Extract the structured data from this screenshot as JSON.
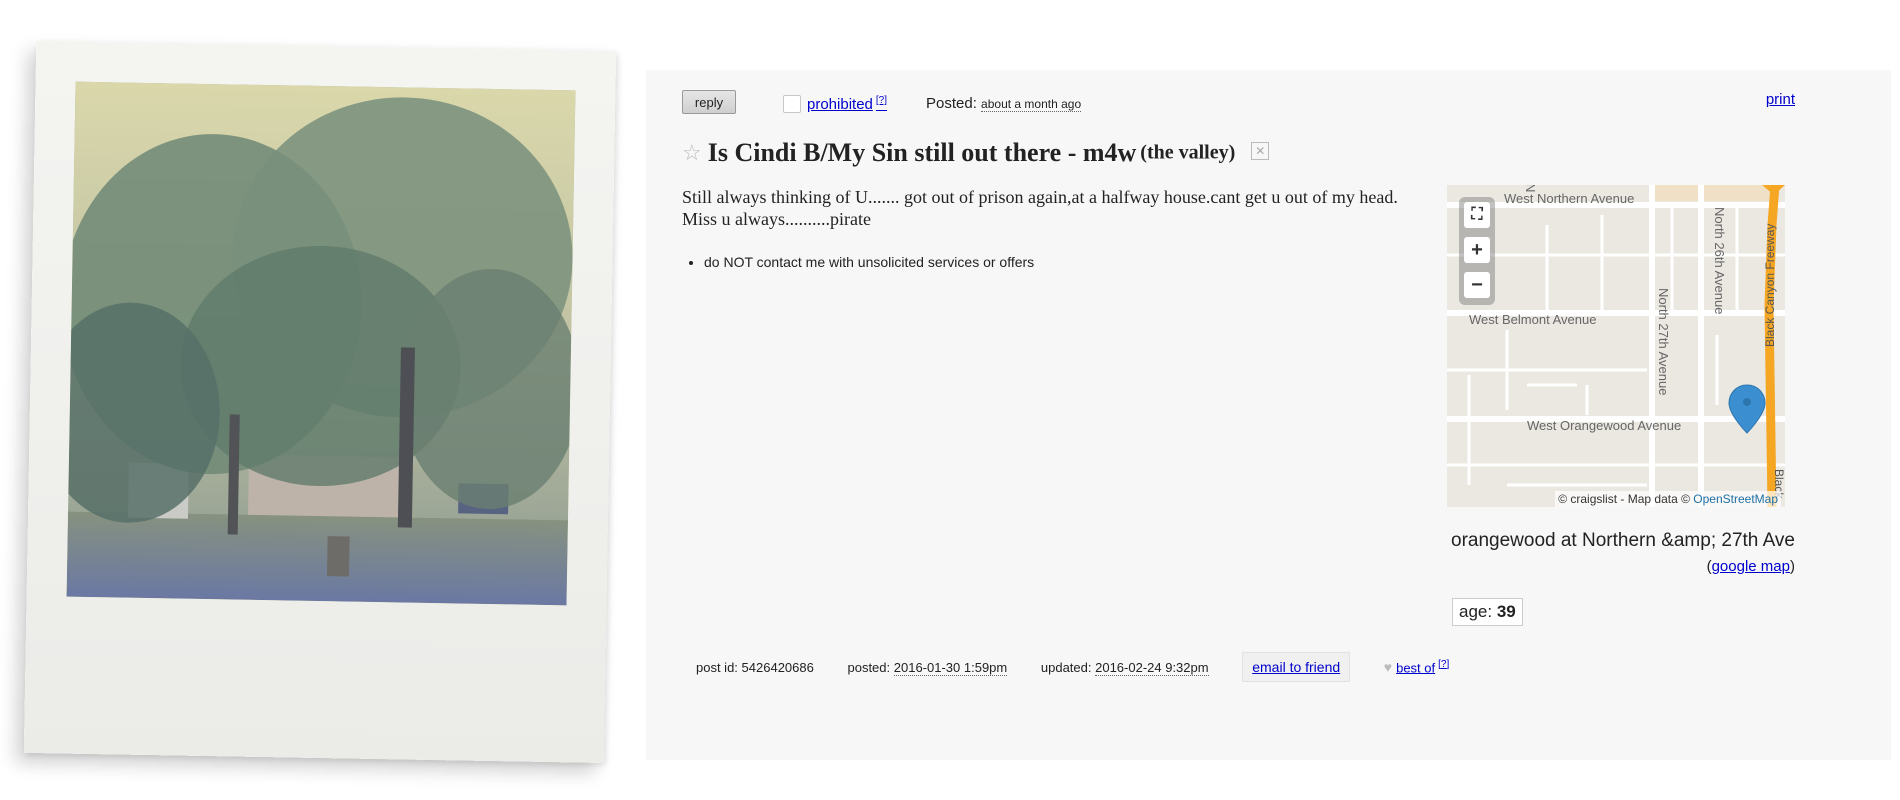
{
  "listing": {
    "reply_label": "reply",
    "prohibited_label": "prohibited",
    "help_marker": "[?]",
    "posted_label": "Posted:",
    "posted_ago": "about a month ago",
    "print_label": "print",
    "title": "Is Cindi B/My Sin still out there - m4w",
    "title_location": "(the valley)",
    "body": "Still always thinking of U....... got out of prison again,at a halfway house.cant get u out of my head. Miss u always..........pirate",
    "notice": "do NOT contact me with unsolicited services or offers"
  },
  "map": {
    "streets": {
      "north": "West Northern Avenue",
      "belmont": "West Belmont Avenue",
      "orangewood": "West Orangewood Avenue",
      "n26": "North 26th Avenue",
      "n27": "North 27th Avenue",
      "freeway": "Black Canyon Freeway",
      "freeway_short": "Black",
      "n_short": "N"
    },
    "attribution_prefix": "© craigslist - Map data ©",
    "attribution_link": "OpenStreetMap",
    "location": "orangewood at Northern &amp; 27th Ave",
    "google_map_label": "google map"
  },
  "attributes": {
    "age_label": "age:",
    "age_value": "39"
  },
  "footer": {
    "post_id_label": "post id:",
    "post_id": "5426420686",
    "posted_label": "posted:",
    "posted_date": "2016-01-30 1:59pm",
    "updated_label": "updated:",
    "updated_date": "2016-02-24 9:32pm",
    "email_label": "email to friend",
    "best_of_label": "best of",
    "help_marker": "[?]"
  },
  "colors": {
    "link": "#0000cc",
    "panel_bg": "#f7f7f7",
    "freeway": "#f5a623",
    "marker": "#3b8fd0"
  }
}
